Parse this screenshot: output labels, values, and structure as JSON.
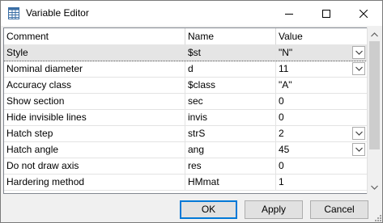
{
  "window": {
    "title": "Variable Editor",
    "icon": "spreadsheet-icon"
  },
  "grid": {
    "columns": [
      "Comment",
      "Name",
      "Value"
    ],
    "rows": [
      {
        "comment": "Style",
        "name": "$st",
        "value": "\"N\"",
        "dropdown": true,
        "selected": true
      },
      {
        "comment": "Nominal diameter",
        "name": "d",
        "value": "11",
        "dropdown": true,
        "selected": false
      },
      {
        "comment": "Accuracy class",
        "name": "$class",
        "value": "\"A\"",
        "dropdown": false,
        "selected": false
      },
      {
        "comment": "Show section",
        "name": "sec",
        "value": "0",
        "dropdown": false,
        "selected": false
      },
      {
        "comment": "Hide invisible lines",
        "name": "invis",
        "value": "0",
        "dropdown": false,
        "selected": false
      },
      {
        "comment": "Hatch step",
        "name": "strS",
        "value": "2",
        "dropdown": true,
        "selected": false
      },
      {
        "comment": "Hatch angle",
        "name": "ang",
        "value": "45",
        "dropdown": true,
        "selected": false
      },
      {
        "comment": "Do not draw axis",
        "name": "res",
        "value": "0",
        "dropdown": false,
        "selected": false
      },
      {
        "comment": "Hardering method",
        "name": "HMmat",
        "value": "1",
        "dropdown": false,
        "selected": false
      }
    ]
  },
  "buttons": {
    "ok": "OK",
    "apply": "Apply",
    "cancel": "Cancel"
  }
}
